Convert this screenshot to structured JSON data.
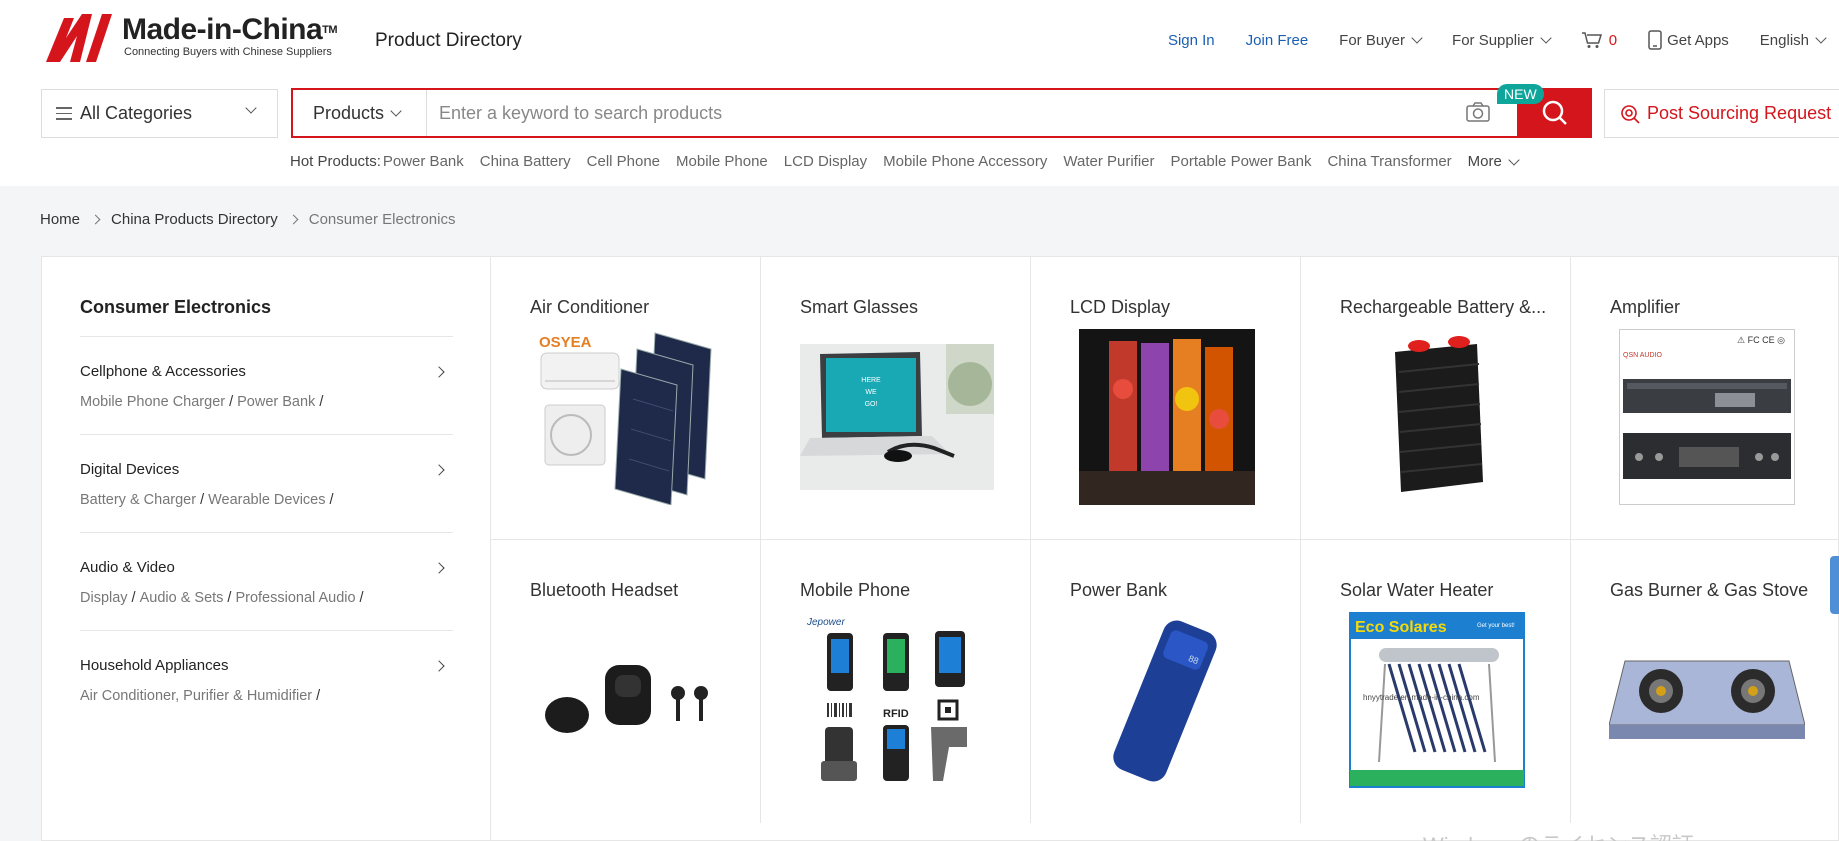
{
  "brand": {
    "name": "Made-in-China",
    "trademark": "TM",
    "tagline": "Connecting Buyers with Chinese Suppliers",
    "section": "Product Directory",
    "color": "#d4151c"
  },
  "top_nav": {
    "sign_in": "Sign In",
    "join_free": "Join Free",
    "for_buyer": "For Buyer",
    "for_supplier": "For Supplier",
    "cart_count": "0",
    "get_apps": "Get Apps",
    "language": "English"
  },
  "search": {
    "all_categories": "All Categories",
    "type": "Products",
    "placeholder": "Enter a keyword to search products",
    "new_badge": "NEW",
    "post_sourcing": "Post Sourcing Request"
  },
  "hot_products": {
    "label": "Hot Products:",
    "items": [
      "Power Bank",
      "China Battery",
      "Cell Phone",
      "Mobile Phone",
      "LCD Display",
      "Mobile Phone Accessory",
      "Water Purifier",
      "Portable Power Bank",
      "China Transformer"
    ],
    "more": "More"
  },
  "breadcrumb": [
    "Home",
    "China Products Directory",
    "Consumer Electronics"
  ],
  "sidebar": {
    "title": "Consumer Electronics",
    "groups": [
      {
        "name": "Cellphone & Accessories",
        "subs": [
          "Mobile Phone Charger",
          "Power Bank"
        ]
      },
      {
        "name": "Digital Devices",
        "subs": [
          "Battery & Charger",
          "Wearable Devices"
        ]
      },
      {
        "name": "Audio & Video",
        "subs": [
          "Display",
          "Audio & Sets",
          "Professional Audio"
        ]
      },
      {
        "name": "Household Appliances",
        "subs": [
          "Air Conditioner, Purifier & Humidifier"
        ]
      }
    ]
  },
  "products": [
    {
      "label": "Air Conditioner",
      "icon": "air-conditioner-image",
      "brand_text": "OSYEA"
    },
    {
      "label": "Smart Glasses",
      "icon": "smart-glasses-image",
      "screen_text": "HERE WE GO!"
    },
    {
      "label": "LCD Display",
      "icon": "lcd-display-image"
    },
    {
      "label": "Rechargeable Battery &...",
      "icon": "battery-image"
    },
    {
      "label": "Amplifier",
      "icon": "amplifier-image",
      "brand_text": "QSN AUDIO"
    },
    {
      "label": "Bluetooth Headset",
      "icon": "bluetooth-headset-image"
    },
    {
      "label": "Mobile Phone",
      "icon": "mobile-phone-image",
      "brand_text": "Jepower",
      "rfid_text": "RFID"
    },
    {
      "label": "Power Bank",
      "icon": "power-bank-image"
    },
    {
      "label": "Solar Water Heater",
      "icon": "solar-water-heater-image",
      "brand_text": "Eco Solares",
      "badge_text": "Get your best!",
      "url_text": "hnyytrade.en.made-in-china.com"
    },
    {
      "label": "Gas Burner & Gas Stove",
      "icon": "gas-stove-image"
    }
  ],
  "watermark": "Windows のライセンス認証"
}
